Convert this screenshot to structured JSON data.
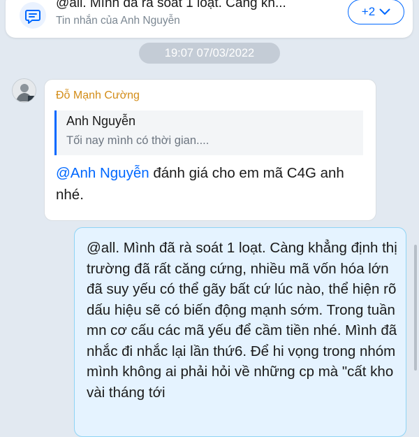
{
  "pinned": {
    "title": "@all. Mình đã rà soát 1 loạt. Càng kh...",
    "subtitle": "Tin nhắn của Anh Nguyễn",
    "more_label": "+2",
    "accent": "#0068ff"
  },
  "timestamp": "19:07 07/03/2022",
  "incoming": {
    "sender": "Đỗ Mạnh Cường",
    "quote": {
      "author": "Anh Nguyễn",
      "text": "Tối nay mình có thời gian...."
    },
    "mention": "@Anh Nguyễn",
    "text": " đánh giá cho em mã C4G anh nhé."
  },
  "outgoing": {
    "text": "@all. Mình đã rà soát 1 loạt. Càng khẳng định thị trường đã rất căng cứng, nhiều mã vốn hóa lớn đã suy yếu có thể gãy bất cứ lúc nào, thể hiện rõ dấu hiệu sẽ có biến động mạnh sớm. Trong tuần mn cơ cấu các mã yếu để cầm tiền nhé. Mình đã nhắc đi nhắc lại lần thứ6. Để hi vọng trong nhóm mình không ai phải hỏi về những cp mà \"cất kho vài tháng tới"
  },
  "colors": {
    "background": "#e2e9f1",
    "sender_name": "#d38c17",
    "mention": "#0068ff",
    "outgoing_bubble": "#e5f3ff"
  }
}
